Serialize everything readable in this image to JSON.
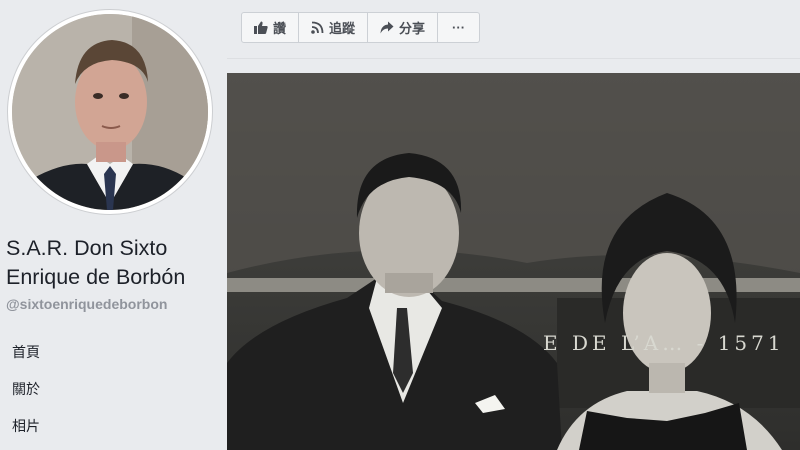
{
  "page": {
    "name_line1": "S.A.R. Don Sixto",
    "name_line2": "Enrique de Borbón",
    "handle": "@sixtoenriquedeborbon"
  },
  "sidebar": {
    "items": [
      {
        "label": "首頁"
      },
      {
        "label": "關於"
      },
      {
        "label": "相片"
      }
    ]
  },
  "actions": {
    "like_label": "讚",
    "follow_label": "追蹤",
    "share_label": "分享",
    "more_label": "···"
  },
  "cover": {
    "inscription": "E DE L’A… - 1571"
  },
  "icons": [
    "thumbs-up-icon",
    "rss-icon",
    "share-arrow-icon",
    "more-icon"
  ],
  "colors": {
    "background": "#e9ebee",
    "text": "#1d2129",
    "muted": "#90949c",
    "button_text": "#4b4f56"
  }
}
